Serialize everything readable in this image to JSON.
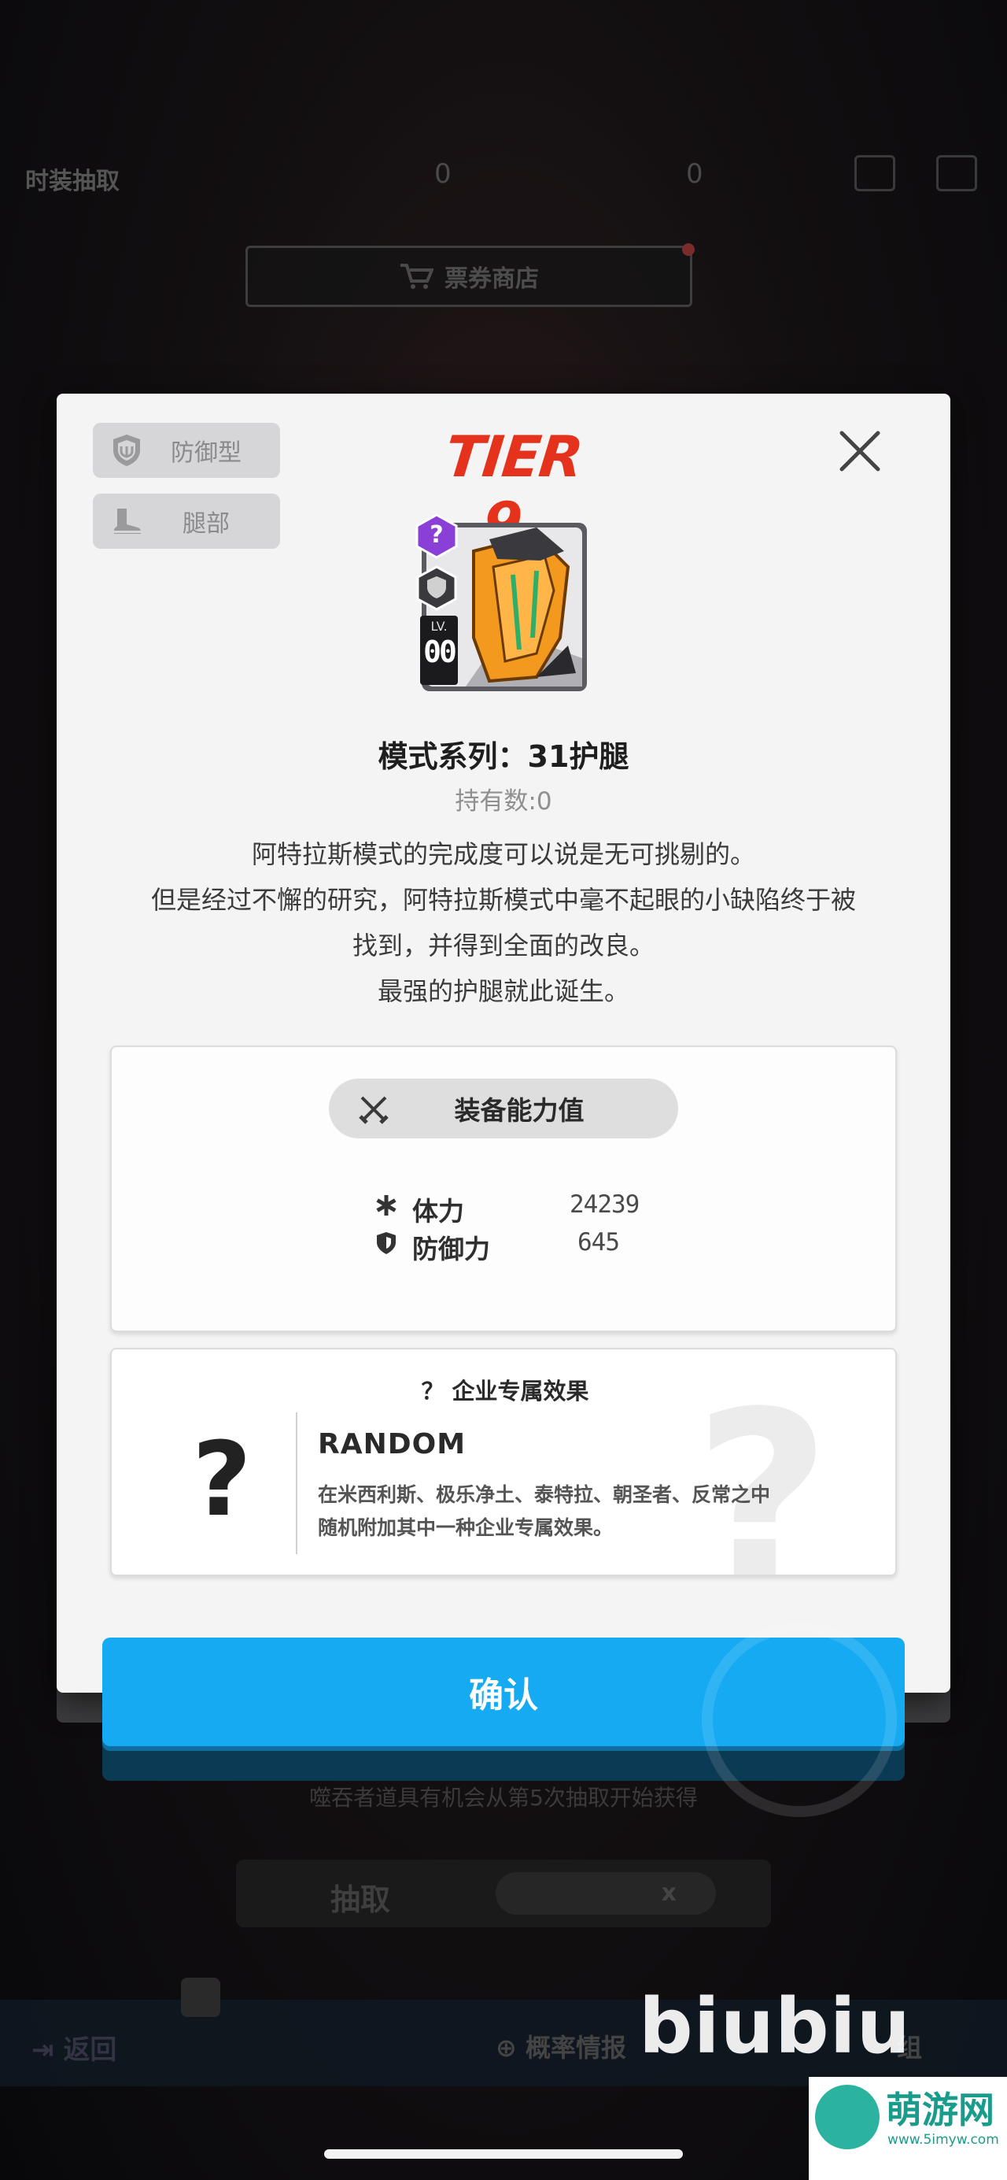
{
  "background": {
    "title": "时装抽取",
    "resource_1": "0",
    "resource_2": "0",
    "shop_button": "票券商店",
    "hint": "噬吞者道具有机会从第5次抽取开始获得",
    "draw_button": "抽取",
    "draw_cost": "x",
    "back_label": "返回",
    "probability_label": "概率情报",
    "right_label": "组"
  },
  "modal": {
    "tag_type": "防御型",
    "tag_slot": "腿部",
    "tier": "TIER 9",
    "item": {
      "rarity_mark": "?",
      "level_label": "LV.",
      "level_value": "00"
    },
    "title": "模式系列：31护腿",
    "owned": "持有数:0",
    "description": [
      "阿特拉斯模式的完成度可以说是无可挑剔的。",
      "但是经过不懈的研究，阿特拉斯模式中毫不起眼的小缺陷终于被",
      "找到，并得到全面的改良。",
      "最强的护腿就此诞生。"
    ],
    "stats": {
      "header": "装备能力值",
      "rows": [
        {
          "label": "体力",
          "value": "24239",
          "icon": "asterisk-icon"
        },
        {
          "label": "防御力",
          "value": "645",
          "icon": "shield-icon"
        }
      ]
    },
    "effect": {
      "title": "？ 企业专属效果",
      "big_mark": "?",
      "name": "RANDOM",
      "text_1": "在米西利斯、极乐净土、泰特拉、朝圣者、反常之中",
      "text_2": "随机附加其中一种企业专属效果。",
      "watermark": "?"
    },
    "confirm": "确认"
  },
  "watermarks": {
    "biubiu": "biubiu",
    "site_name": "萌游网",
    "site_url": "www.5imyw.com"
  },
  "colors": {
    "tier_red": "#e5321d",
    "confirm_blue": "#15aaf2",
    "rarity_purple": "#8a3fd6"
  }
}
